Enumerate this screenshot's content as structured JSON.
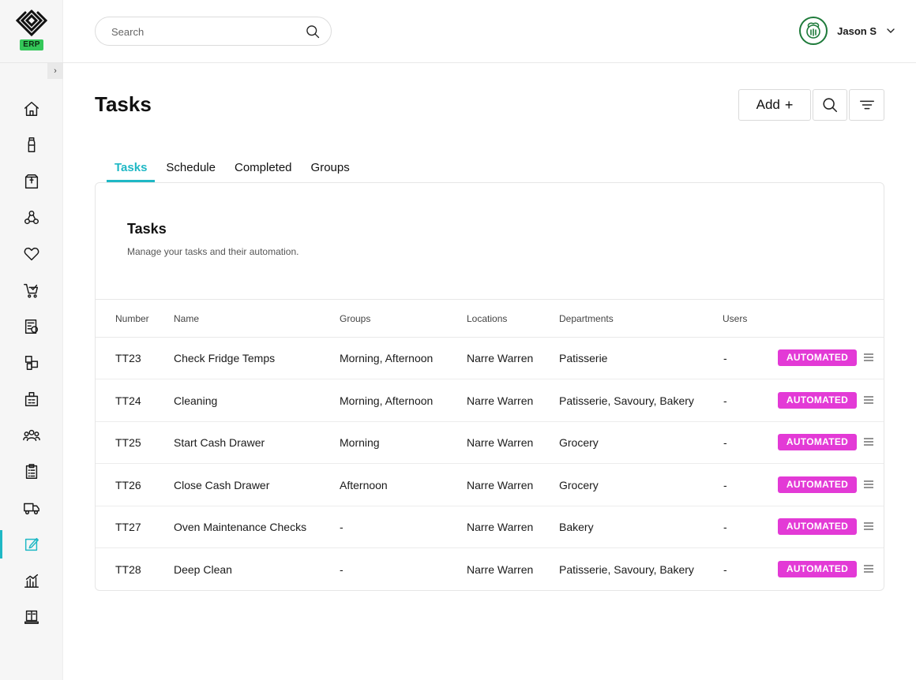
{
  "app": {
    "badge": "ERP"
  },
  "header": {
    "search_placeholder": "Search",
    "user_name": "Jason S"
  },
  "sidebar": {
    "items": [
      {
        "icon": "home-icon"
      },
      {
        "icon": "bottle-icon"
      },
      {
        "icon": "package-icon"
      },
      {
        "icon": "network-icon"
      },
      {
        "icon": "heart-icon"
      },
      {
        "icon": "cart-check-icon"
      },
      {
        "icon": "invoice-icon"
      },
      {
        "icon": "boxes-icon"
      },
      {
        "icon": "warehouse-icon"
      },
      {
        "icon": "people-icon"
      },
      {
        "icon": "clipboard-icon"
      },
      {
        "icon": "truck-icon"
      },
      {
        "icon": "edit-icon",
        "active": true
      },
      {
        "icon": "chart-icon"
      },
      {
        "icon": "book-icon"
      }
    ]
  },
  "page": {
    "title": "Tasks",
    "add_label": "Add",
    "add_symbol": "+"
  },
  "tabs": [
    {
      "label": "Tasks",
      "active": true
    },
    {
      "label": "Schedule"
    },
    {
      "label": "Completed"
    },
    {
      "label": "Groups"
    }
  ],
  "card": {
    "title": "Tasks",
    "subtitle": "Manage your tasks and their automation."
  },
  "table": {
    "columns": [
      "Number",
      "Name",
      "Groups",
      "Locations",
      "Departments",
      "Users"
    ],
    "rows": [
      {
        "number": "TT23",
        "name": "Check Fridge Temps",
        "groups": "Morning, Afternoon",
        "location": "Narre Warren",
        "departments": "Patisserie",
        "users": "-",
        "status": "AUTOMATED"
      },
      {
        "number": "TT24",
        "name": "Cleaning",
        "groups": "Morning, Afternoon",
        "location": "Narre Warren",
        "departments": "Patisserie, Savoury, Bakery",
        "users": "-",
        "status": "AUTOMATED"
      },
      {
        "number": "TT25",
        "name": "Start Cash Drawer",
        "groups": "Morning",
        "location": "Narre Warren",
        "departments": "Grocery",
        "users": "-",
        "status": "AUTOMATED"
      },
      {
        "number": "TT26",
        "name": "Close Cash Drawer",
        "groups": "Afternoon",
        "location": "Narre Warren",
        "departments": "Grocery",
        "users": "-",
        "status": "AUTOMATED"
      },
      {
        "number": "TT27",
        "name": "Oven Maintenance Checks",
        "groups": "-",
        "location": "Narre Warren",
        "departments": "Bakery",
        "users": "-",
        "status": "AUTOMATED"
      },
      {
        "number": "TT28",
        "name": "Deep Clean",
        "groups": "-",
        "location": "Narre Warren",
        "departments": "Patisserie, Savoury, Bakery",
        "users": "-",
        "status": "AUTOMATED"
      }
    ]
  },
  "colors": {
    "accent": "#1fb8c5",
    "badge": "#e33ad6",
    "erp": "#34c759"
  }
}
